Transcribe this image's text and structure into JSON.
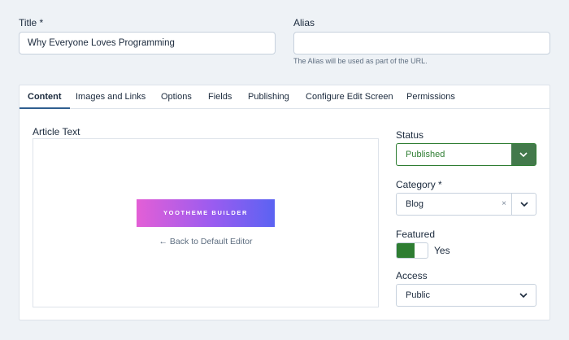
{
  "title_field": {
    "label": "Title *",
    "value": "Why Everyone Loves Programming"
  },
  "alias_field": {
    "label": "Alias",
    "value": "",
    "hint": "The Alias will be used as part of the URL."
  },
  "tabs": [
    {
      "label": "Content"
    },
    {
      "label": "Images and Links"
    },
    {
      "label": "Options"
    },
    {
      "label": "Fields"
    },
    {
      "label": "Publishing"
    },
    {
      "label": "Configure Edit Screen"
    },
    {
      "label": "Permissions"
    }
  ],
  "active_tab": "Content",
  "editor": {
    "label": "Article Text",
    "builder_button": "YOOTHEME BUILDER",
    "back_link": "← Back to Default Editor"
  },
  "status": {
    "label": "Status",
    "value": "Published"
  },
  "category": {
    "label": "Category *",
    "value": "Blog",
    "clear": "×"
  },
  "featured": {
    "label": "Featured",
    "value_label": "Yes",
    "on": true
  },
  "access": {
    "label": "Access",
    "value": "Public"
  },
  "colors": {
    "accent": "#2f5e8f",
    "status_green": "#43794b",
    "toggle_on": "#2e7d32",
    "builder_gradient": [
      "#e35fd6",
      "#5b63f2"
    ]
  },
  "icons": {
    "chevron": "chevron-down-icon",
    "clear": "clear-icon"
  }
}
